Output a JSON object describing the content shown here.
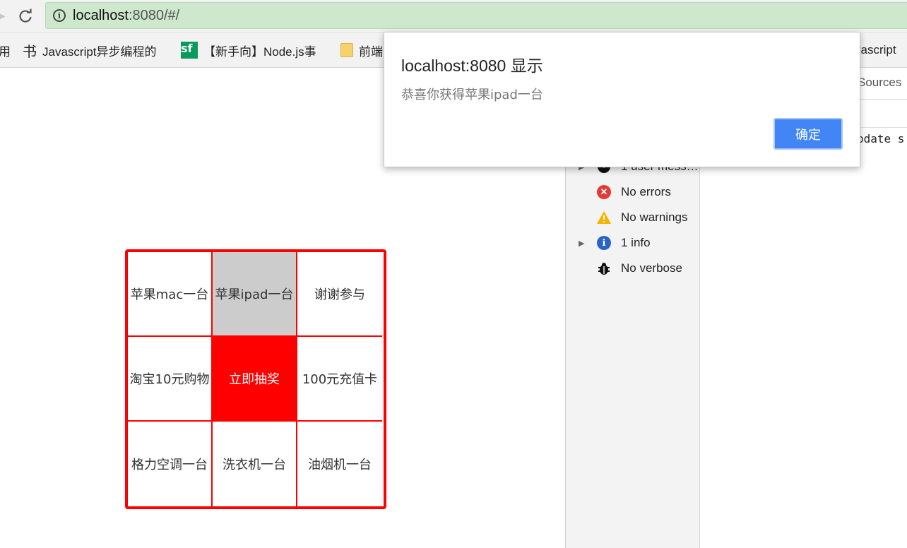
{
  "browser": {
    "url_host": "localhost",
    "url_rest": ":8080/#/"
  },
  "bookmarks": [
    {
      "label": "用",
      "icon": "app-icon"
    },
    {
      "label": "Javascript异步编程的",
      "icon": "calligraphy-icon"
    },
    {
      "label": "【新手向】Node.js事",
      "icon": "sf-icon"
    },
    {
      "label": "前端",
      "icon": "folder-icon"
    },
    {
      "label": "vascript",
      "icon": "page-icon"
    }
  ],
  "dialog": {
    "title": "localhost:8080 显示",
    "message": "恭喜你获得苹果ipad一台",
    "ok_label": "确定"
  },
  "devtools": {
    "tab_sources": "Sources",
    "console_snippet": "pdate s",
    "filters": [
      {
        "label": "1 user mess…",
        "icon": "user-icon",
        "expandable": true
      },
      {
        "label": "No errors",
        "icon": "error-icon",
        "expandable": false
      },
      {
        "label": "No warnings",
        "icon": "warning-icon",
        "expandable": false
      },
      {
        "label": "1 info",
        "icon": "info-icon",
        "expandable": true
      },
      {
        "label": "No verbose",
        "icon": "bug-icon",
        "expandable": false
      }
    ]
  },
  "lottery": {
    "cells": [
      "苹果mac一台",
      "苹果ipad一台",
      "谢谢参与",
      "淘宝10元购物",
      "立即抽奖",
      "100元充值卡",
      "格力空调一台",
      "洗衣机一台",
      "油烟机一台"
    ],
    "active_prize_index": 1,
    "colors": {
      "border": "#ff0000",
      "active": "#cccccc",
      "draw_button": "#ff0000"
    }
  }
}
